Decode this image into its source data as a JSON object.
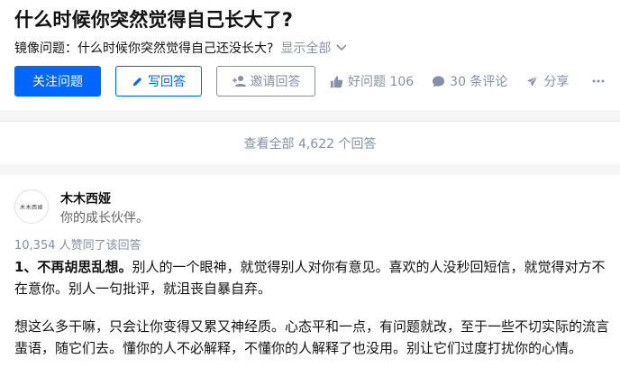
{
  "question": {
    "title": "什么时候你突然觉得自己长大了?",
    "mirror_label": "镜像问题：什么时候你突然觉得自己还没长大?",
    "show_all": "显示全部"
  },
  "actions": {
    "follow": "关注问题",
    "write": "写回答",
    "invite": "邀请回答",
    "good_question": "好问题 106",
    "comments": "30 条评论",
    "share": "分享"
  },
  "view_all": "查看全部 4,622 个回答",
  "answer": {
    "avatar_text": "木木西娅",
    "author": "木木西娅",
    "bio": "你的成长伙伴。",
    "votes": "10,354 人赞同了该回答",
    "p1_bold": "1、不再胡思乱想。",
    "p1_rest": "别人的一个眼神，就觉得别人对你有意见。喜欢的人没秒回短信，就觉得对方不在意你。别人一句批评，就沮丧自暴自弃。",
    "p2": "想这么多干嘛，只会让你变得又累又神经质。心态平和一点，有问题就改，至于一些不切实际的流言蜚语，随它们去。懂你的人不必解释，不懂你的人解释了也没用。别让它们过度打扰你的心情。"
  }
}
